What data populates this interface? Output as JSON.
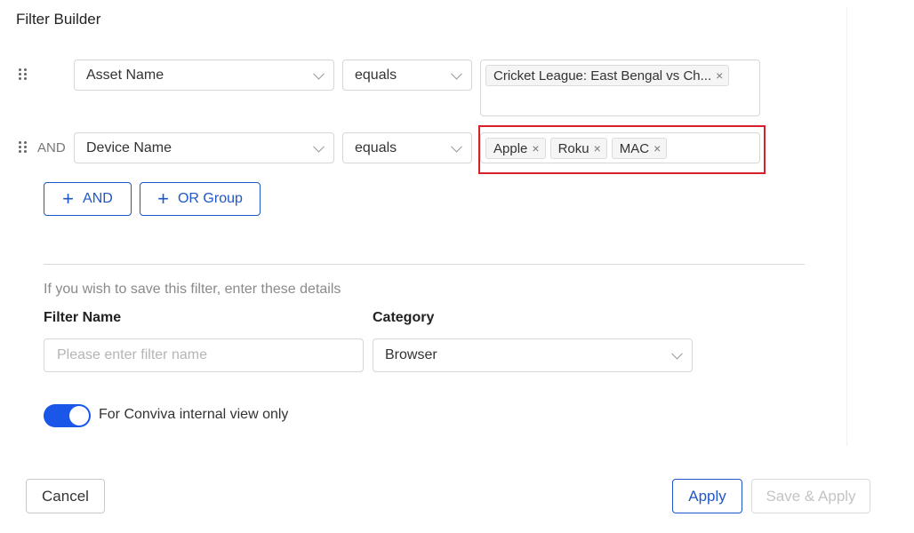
{
  "title": "Filter Builder",
  "rows": [
    {
      "connector": "",
      "field": "Asset Name",
      "operator": "equals",
      "values": [
        "Cricket League: East Bengal vs Ch..."
      ]
    },
    {
      "connector": "AND",
      "field": "Device Name",
      "operator": "equals",
      "values": [
        "Apple",
        "Roku",
        "MAC"
      ]
    }
  ],
  "add_buttons": {
    "and_label": "AND",
    "or_group_label": "OR Group"
  },
  "save_section": {
    "hint": "If you wish to save this filter, enter these details",
    "filter_name_label": "Filter Name",
    "filter_name_placeholder": "Please enter filter name",
    "filter_name_value": "",
    "category_label": "Category",
    "category_value": "Browser"
  },
  "internal_toggle": {
    "label": "For Conviva internal view only",
    "on": true
  },
  "footer": {
    "cancel_label": "Cancel",
    "apply_label": "Apply",
    "save_apply_label": "Save & Apply"
  },
  "colors": {
    "accent": "#1f56c8",
    "toggle_on": "#1a56e8",
    "highlight": "#d6202a"
  }
}
